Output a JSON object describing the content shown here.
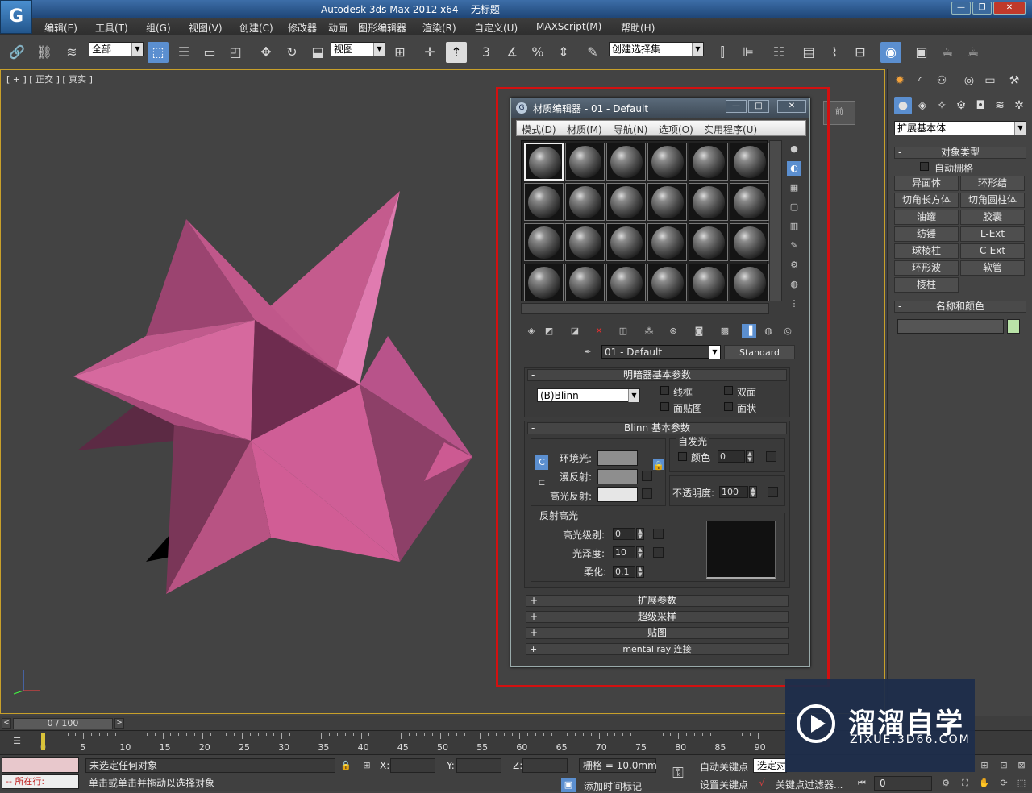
{
  "app": {
    "title": "Autodesk 3ds Max  2012 x64",
    "doc": "无标题"
  },
  "menu": [
    "编辑(E)",
    "工具(T)",
    "组(G)",
    "视图(V)",
    "创建(C)",
    "修改器",
    "动画",
    "图形编辑器",
    "渲染(R)",
    "自定义(U)",
    "MAXScript(M)",
    "帮助(H)"
  ],
  "toolbar": {
    "filter_select": "全部",
    "ref_coord": "视图",
    "angle_snap": "3",
    "selection_set": "创建选择集"
  },
  "viewport": {
    "label": "[ + ] [ 正交 ] [ 真实 ]",
    "viewcube": "前",
    "object_color": "#d4609a"
  },
  "cmdpanel": {
    "category": "扩展基本体",
    "object_type": {
      "title": "对象类型",
      "autogrid": "自动栅格",
      "buttons": [
        "异面体",
        "环形结",
        "切角长方体",
        "切角圆柱体",
        "油罐",
        "胶囊",
        "纺锤",
        "L-Ext",
        "球棱柱",
        "C-Ext",
        "环形波",
        "软管",
        "棱柱"
      ]
    },
    "name_color": {
      "title": "名称和颜色",
      "color": "#b9e3a8"
    }
  },
  "mat_editor": {
    "title": "材质编辑器 - 01 - Default",
    "menu": [
      "模式(D)",
      "材质(M)",
      "导航(N)",
      "选项(O)",
      "实用程序(U)"
    ],
    "material_name": "01 - Default",
    "material_type": "Standard",
    "shader_rollout": {
      "title": "明暗器基本参数",
      "shader": "(B)Blinn",
      "wire": "线框",
      "two_sided": "双面",
      "face_map": "面贴图",
      "faceted": "面状"
    },
    "blinn_rollout": {
      "title": "Blinn 基本参数",
      "self_illum": "自发光",
      "color": "颜色",
      "self_illum_value": "0",
      "ambient": "环境光:",
      "diffuse": "漫反射:",
      "specular": "高光反射:",
      "opacity": "不透明度:",
      "opacity_value": "100",
      "spec_highlights": "反射高光",
      "spec_level": "高光级别:",
      "spec_level_value": "0",
      "glossiness": "光泽度:",
      "glossiness_value": "10",
      "soften": "柔化:",
      "soften_value": "0.1"
    },
    "collapsed": [
      "扩展参数",
      "超级采样",
      "贴图",
      "mental ray 连接"
    ]
  },
  "timeline": {
    "frame": "0 / 100",
    "ticks": [
      "0",
      "5",
      "10",
      "15",
      "20",
      "25",
      "30",
      "35",
      "40",
      "45",
      "50",
      "55",
      "60",
      "65",
      "70",
      "75",
      "80",
      "85",
      "90"
    ]
  },
  "status": {
    "selection": "未选定任何对象",
    "prompt": "单击或单击并拖动以选择对象",
    "running": "所在行:",
    "x": "X:",
    "y": "Y:",
    "z": "Z:",
    "grid": "栅格 = 10.0mm",
    "auto_key": "自动关键点",
    "set_key": "设置关键点",
    "selected": "选定对",
    "add_time_tag": "添加时间标记",
    "key_filter": "关键点过滤器...",
    "frame_value": "0"
  },
  "watermark": {
    "name": "溜溜自学",
    "url": "ZIXUE.3D66.COM"
  }
}
